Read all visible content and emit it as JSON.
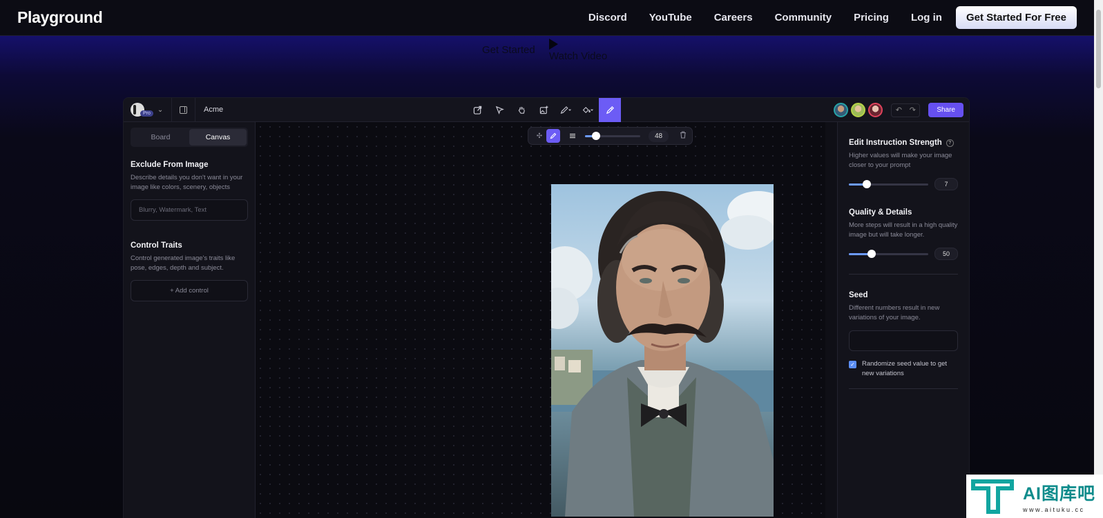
{
  "nav": {
    "brand": "Playground",
    "links": [
      "Discord",
      "YouTube",
      "Careers",
      "Community",
      "Pricing",
      "Log in"
    ],
    "cta": "Get Started For Free"
  },
  "hero": {
    "get_started": "Get Started",
    "watch_video": "Watch Video"
  },
  "app": {
    "pro_badge": "Pro",
    "project_name": "Acme",
    "share": "Share",
    "toolbar_icons": [
      "export-icon",
      "pointer-icon",
      "hand-icon",
      "add-image-icon",
      "pen-icon",
      "fill-icon",
      "brush-icon"
    ],
    "left": {
      "tabs": [
        "Board",
        "Canvas"
      ],
      "active_tab": "Canvas",
      "exclude_title": "Exclude From Image",
      "exclude_desc": "Describe details you don't want in your image like colors, scenery, objects",
      "exclude_placeholder": "Blurry, Watermark, Text",
      "control_title": "Control Traits",
      "control_desc": "Control generated image's traits like pose, edges, depth and subject.",
      "add_control": "+ Add control"
    },
    "brush": {
      "size": "48",
      "size_fraction": 0.2
    },
    "right": {
      "strength_title": "Edit Instruction Strength",
      "strength_desc": "Higher values will make your image closer to your prompt",
      "strength_value": "7",
      "strength_fraction": 0.23,
      "quality_title": "Quality & Details",
      "quality_desc": "More steps will result in a high quality image but will take longer.",
      "quality_value": "50",
      "quality_fraction": 0.29,
      "seed_title": "Seed",
      "seed_desc": "Different numbers result in new variations of your image.",
      "randomize_label": "Randomize seed value to get new variations",
      "randomize_checked": true
    }
  },
  "watermark": {
    "text": "AI图库吧",
    "url": "www.aituku.cc"
  },
  "colors": {
    "accent": "#6c5cf5",
    "share": "#6650f0",
    "slider": "#6c9bff"
  }
}
